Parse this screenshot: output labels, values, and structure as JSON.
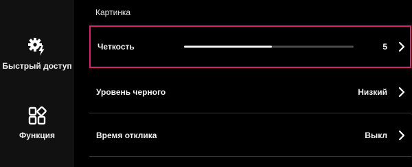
{
  "sidebar": {
    "items": [
      {
        "label": "Быстрый доступ",
        "icon": "gear-bolt-icon"
      },
      {
        "label": "Функция",
        "icon": "grid-function-icon"
      }
    ]
  },
  "main": {
    "section_title": "Картинка",
    "rows": [
      {
        "label": "Четкость",
        "value": "5",
        "slider_fraction": 0.52,
        "focused": true
      },
      {
        "label": "Уровень черного",
        "value": "Низкий"
      },
      {
        "label": "Время отклика",
        "value": "Выкл"
      }
    ]
  },
  "colors": {
    "focus_border": "#d6226f",
    "sidebar_bg": "#111111",
    "background": "#000000",
    "text": "#f2f2f2",
    "divider": "#3a3a3a",
    "slider_track": "#4a4a4a",
    "slider_fill": "#f2f2f2"
  }
}
